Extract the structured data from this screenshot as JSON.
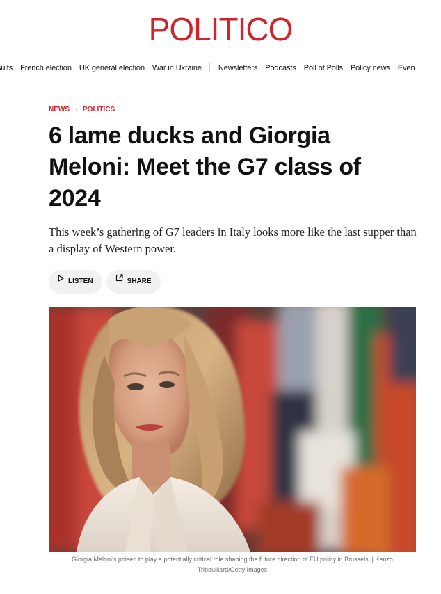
{
  "brand": {
    "logo_text": "POLITICO",
    "accent_color": "#d2232a"
  },
  "nav": {
    "items": [
      "esults",
      "French election",
      "UK general election",
      "War in Ukraine",
      "Newsletters",
      "Podcasts",
      "Poll of Polls",
      "Policy news",
      "Even"
    ]
  },
  "breadcrumb": {
    "section": "NEWS",
    "subsection": "POLITICS",
    "separator": "›"
  },
  "article": {
    "headline": "6 lame ducks and Giorgia Meloni: Meet the G7 class of 2024",
    "dek": "This week’s gathering of G7 leaders in Italy looks more like the last supper than a display of Western power."
  },
  "actions": {
    "listen_label": "LISTEN",
    "listen_icon": "play-icon",
    "share_label": "SHARE",
    "share_icon": "share-icon"
  },
  "image": {
    "caption": "Giorgia Meloni’s poised to play a potentially critical role shaping the future direction of EU policy in Brussels. | Kenzo Tribouillard/Getty Images"
  }
}
